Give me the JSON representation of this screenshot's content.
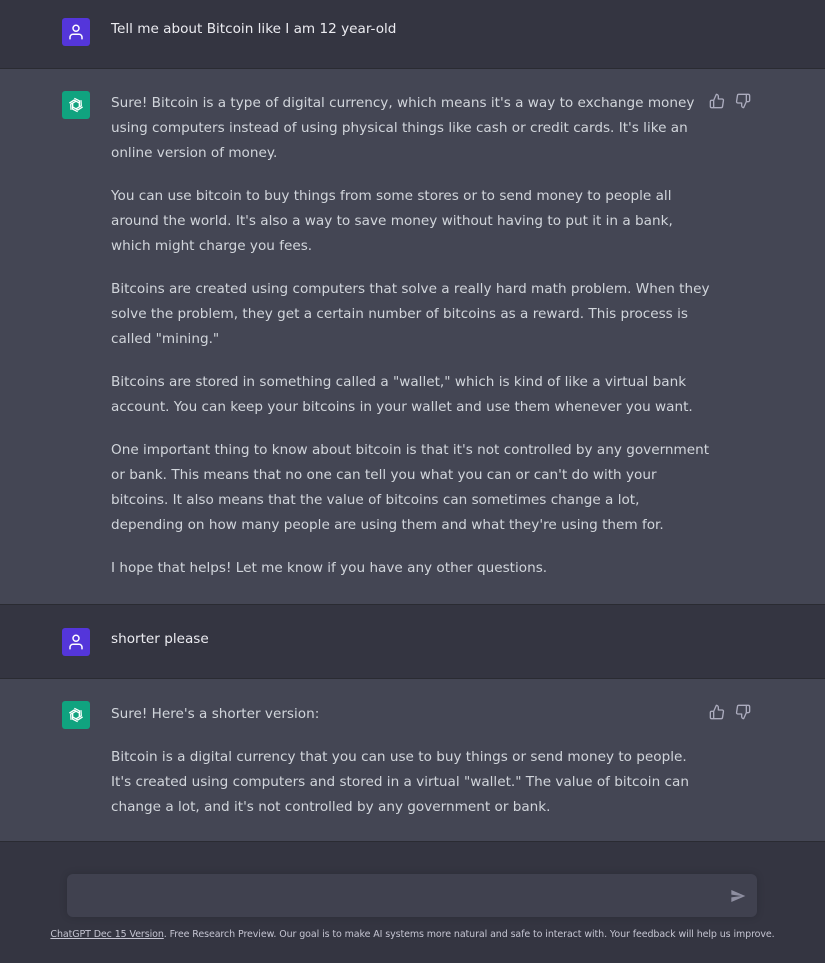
{
  "conversation": [
    {
      "role": "user",
      "avatar_icon": "user-icon",
      "text": "Tell me about Bitcoin like I am 12 year-old"
    },
    {
      "role": "assistant",
      "avatar_icon": "openai-logo-icon",
      "paragraphs": [
        "Sure! Bitcoin is a type of digital currency, which means it's a way to exchange money using computers instead of using physical things like cash or credit cards. It's like an online version of money.",
        "You can use bitcoin to buy things from some stores or to send money to people all around the world. It's also a way to save money without having to put it in a bank, which might charge you fees.",
        "Bitcoins are created using computers that solve a really hard math problem. When they solve the problem, they get a certain number of bitcoins as a reward. This process is called \"mining.\"",
        "Bitcoins are stored in something called a \"wallet,\" which is kind of like a virtual bank account. You can keep your bitcoins in your wallet and use them whenever you want.",
        "One important thing to know about bitcoin is that it's not controlled by any government or bank. This means that no one can tell you what you can or can't do with your bitcoins. It also means that the value of bitcoins can sometimes change a lot, depending on how many people are using them and what they're using them for.",
        "I hope that helps! Let me know if you have any other questions."
      ]
    },
    {
      "role": "user",
      "avatar_icon": "user-icon",
      "text": "shorter please"
    },
    {
      "role": "assistant",
      "avatar_icon": "openai-logo-icon",
      "paragraphs": [
        "Sure! Here's a shorter version:",
        "Bitcoin is a digital currency that you can use to buy things or send money to people. It's created using computers and stored in a virtual \"wallet.\" The value of bitcoin can change a lot, and it's not controlled by any government or bank."
      ]
    }
  ],
  "composer": {
    "value": "",
    "send_icon": "send-icon"
  },
  "footer": {
    "version_link": "ChatGPT Dec 15 Version",
    "text": ". Free Research Preview. Our goal is to make AI systems more natural and safe to interact with. Your feedback will help us improve."
  },
  "colors": {
    "user_bg": "#343541",
    "assistant_bg": "#444654",
    "user_avatar": "#5436da",
    "assistant_avatar": "#10a37f"
  }
}
